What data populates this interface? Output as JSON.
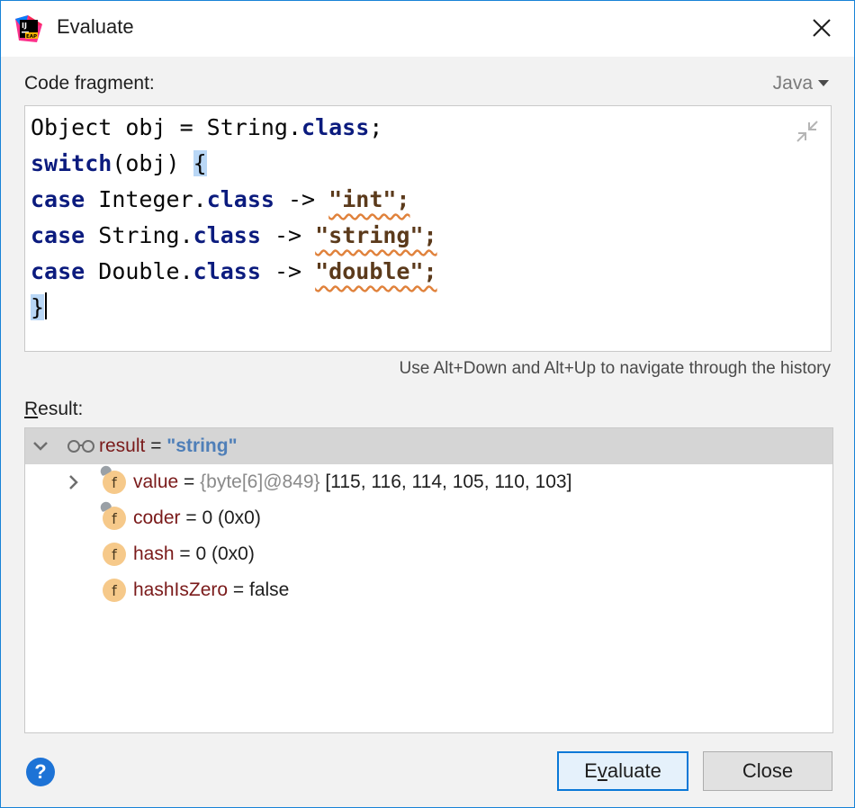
{
  "window": {
    "title": "Evaluate",
    "app_icon": "intellij-idea-eap-icon"
  },
  "editor": {
    "label": "Code fragment:",
    "language": "Java",
    "hint": "Use Alt+Down and Alt+Up to navigate through the history",
    "lines": [
      "Object obj = String.class;",
      "switch(obj) {",
      "case Integer.class -> \"int\";",
      "case String.class -> \"string\";",
      "case Double.class -> \"double\";",
      "}"
    ]
  },
  "result": {
    "label": "Result:",
    "root": {
      "name": "result",
      "eq": " = ",
      "value": "\"string\""
    },
    "fields": [
      {
        "name": "value",
        "eq": " = ",
        "ref": "{byte[6]@849}",
        "value": " [115, 116, 114, 105, 110, 103]"
      },
      {
        "name": "coder",
        "eq": " = ",
        "value": "0 (0x0)"
      },
      {
        "name": "hash",
        "eq": " = ",
        "value": "0 (0x0)"
      },
      {
        "name": "hashIsZero",
        "eq": " = ",
        "value": "false"
      }
    ]
  },
  "buttons": {
    "evaluate": "Evaluate",
    "close": "Close",
    "help": "?"
  },
  "colors": {
    "accent": "#0a78d7",
    "keyword": "#0b1b7e",
    "field_name": "#7a1a1a",
    "string_value": "#4f7fb8"
  }
}
